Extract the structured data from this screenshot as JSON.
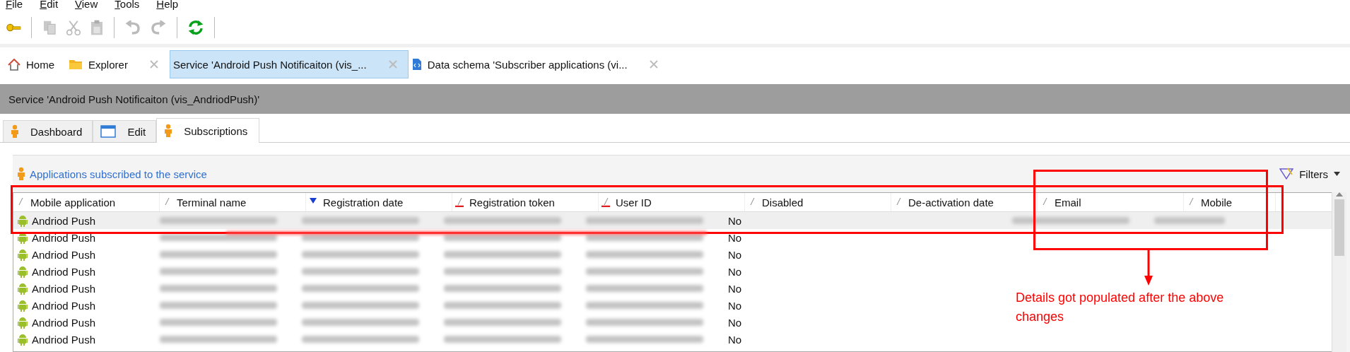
{
  "menu": [
    {
      "label": "File"
    },
    {
      "label": "Edit"
    },
    {
      "label": "View"
    },
    {
      "label": "Tools"
    },
    {
      "label": "Help"
    }
  ],
  "toolbar": [
    {
      "kind": "key",
      "disabled": false
    },
    {
      "kind": "separator"
    },
    {
      "kind": "copy",
      "disabled": true
    },
    {
      "kind": "cut",
      "disabled": true
    },
    {
      "kind": "paste",
      "disabled": true
    },
    {
      "kind": "separator"
    },
    {
      "kind": "undo",
      "disabled": true
    },
    {
      "kind": "redo",
      "disabled": true
    },
    {
      "kind": "separator"
    },
    {
      "kind": "refresh",
      "disabled": false
    },
    {
      "kind": "separator"
    }
  ],
  "doc_tabs": [
    {
      "kind": "home",
      "label": "Home",
      "selected": false,
      "closable": false
    },
    {
      "kind": "folder",
      "label": "Explorer",
      "selected": false,
      "closable": true
    },
    {
      "kind": "plain",
      "label": "Service 'Android Push Notificaiton (vis_...",
      "selected": true,
      "closable": true
    },
    {
      "kind": "schema",
      "label": "Data schema 'Subscriber applications (vi...",
      "selected": false,
      "closable": true
    }
  ],
  "title_bar": "Service 'Android Push Notificaiton (vis_AndriodPush)'",
  "sub_tabs": [
    {
      "kind": "person",
      "label": "Dashboard",
      "selected": false
    },
    {
      "kind": "window",
      "label": "Edit",
      "selected": false
    },
    {
      "kind": "person",
      "label": "Subscriptions",
      "selected": true
    }
  ],
  "panel": {
    "title": "Applications subscribed to the service",
    "filters": "Filters"
  },
  "table": {
    "columns": [
      {
        "label": "Mobile application",
        "sorted": false,
        "flagged": false
      },
      {
        "label": "Terminal name",
        "sorted": false,
        "flagged": false
      },
      {
        "label": "Registration date",
        "sorted": true,
        "flagged": false
      },
      {
        "label": "Registration token",
        "sorted": false,
        "flagged": true
      },
      {
        "label": "User ID",
        "sorted": false,
        "flagged": true
      },
      {
        "label": "Disabled",
        "sorted": false,
        "flagged": false
      },
      {
        "label": "De-activation date",
        "sorted": false,
        "flagged": false
      },
      {
        "label": "Email",
        "sorted": false,
        "flagged": false
      },
      {
        "label": "Mobile",
        "sorted": false,
        "flagged": false
      }
    ],
    "rows": [
      {
        "selected": true,
        "cells": [
          {
            "text": "Andriod Push"
          },
          {
            "blurred": true
          },
          {
            "blurred": true
          },
          {
            "blurred": true
          },
          {
            "blurred": true
          },
          {
            "text": "No"
          },
          {
            "blurred": false
          },
          {
            "blurred": true
          },
          {
            "blurred": true
          }
        ]
      },
      {
        "selected": false,
        "cells": [
          {
            "text": "Andriod Push"
          },
          {
            "blurred": true
          },
          {
            "blurred": true
          },
          {
            "blurred": true
          },
          {
            "blurred": true
          },
          {
            "text": "No"
          }
        ]
      },
      {
        "selected": false,
        "cells": [
          {
            "text": "Andriod Push"
          },
          {
            "blurred": true
          },
          {
            "blurred": true
          },
          {
            "blurred": true
          },
          {
            "blurred": true
          },
          {
            "text": "No"
          }
        ]
      },
      {
        "selected": false,
        "cells": [
          {
            "text": "Andriod Push"
          },
          {
            "blurred": true
          },
          {
            "blurred": true
          },
          {
            "blurred": true
          },
          {
            "blurred": true
          },
          {
            "text": "No"
          }
        ]
      },
      {
        "selected": false,
        "cells": [
          {
            "text": "Andriod Push"
          },
          {
            "blurred": true
          },
          {
            "blurred": true
          },
          {
            "blurred": true
          },
          {
            "blurred": true
          },
          {
            "text": "No"
          }
        ]
      },
      {
        "selected": false,
        "cells": [
          {
            "text": "Andriod Push"
          },
          {
            "blurred": true
          },
          {
            "blurred": true
          },
          {
            "blurred": true
          },
          {
            "blurred": true
          },
          {
            "text": "No"
          }
        ]
      },
      {
        "selected": false,
        "cells": [
          {
            "text": "Andriod Push"
          },
          {
            "blurred": true
          },
          {
            "blurred": true
          },
          {
            "blurred": true
          },
          {
            "blurred": true
          },
          {
            "text": "No"
          }
        ]
      },
      {
        "selected": false,
        "cells": [
          {
            "text": "Andriod Push"
          },
          {
            "blurred": true
          },
          {
            "blurred": true
          },
          {
            "blurred": true
          },
          {
            "blurred": true
          },
          {
            "text": "No"
          }
        ]
      }
    ]
  },
  "annotation": {
    "note": "Details got populated after the above changes"
  }
}
